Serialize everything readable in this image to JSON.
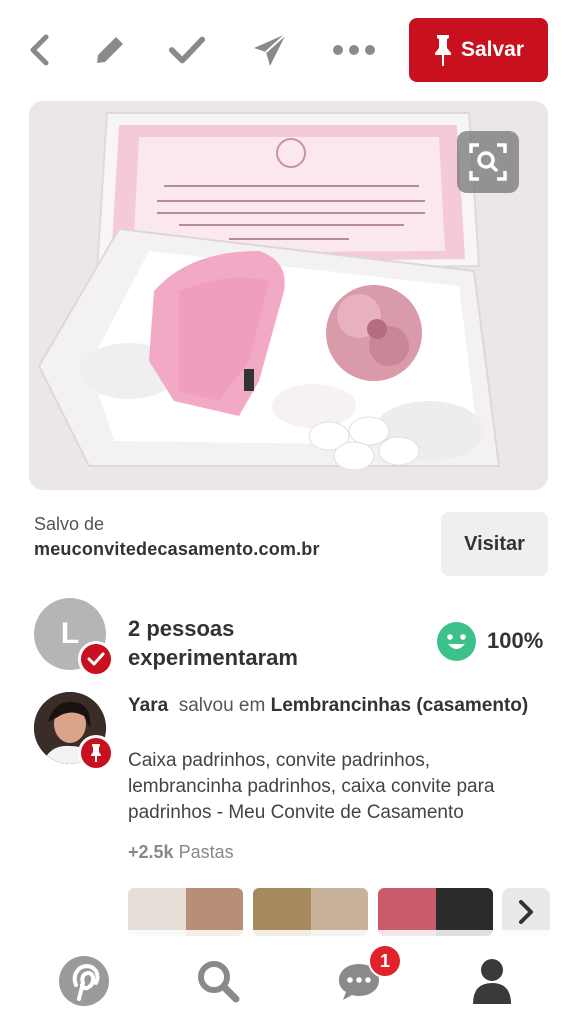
{
  "toolbar": {
    "back_icon": "chevron-left-icon",
    "edit_icon": "pencil-icon",
    "tried_icon": "checkmark-icon",
    "send_icon": "paper-plane-icon",
    "more_icon": "more-dots-icon",
    "save_label": "Salvar",
    "accent_color": "#c8101e"
  },
  "pin": {
    "lens_icon": "visual-search-icon"
  },
  "source": {
    "label": "Salvo de",
    "url": "meuconvitedecasamento.com.br",
    "visit_label": "Visitar"
  },
  "tried": {
    "avatar_letter": "L",
    "text": "2 pessoas experimentaram",
    "rating": "100%"
  },
  "activity": {
    "user": "Yara",
    "saved_in": "salvou em",
    "board": "Lembrancinhas (casamento)",
    "description": "Caixa padrinhos, convite padrinhos, lembrancinha padrinhos, caixa convite para padrinhos - Meu Convite de Casamento",
    "boards_count": "+2.5k",
    "boards_label": "Pastas"
  },
  "nav": {
    "home_icon": "pinterest-logo-icon",
    "search_icon": "search-icon",
    "messages_icon": "chat-bubble-icon",
    "notification_count": "1",
    "profile_icon": "person-icon"
  }
}
